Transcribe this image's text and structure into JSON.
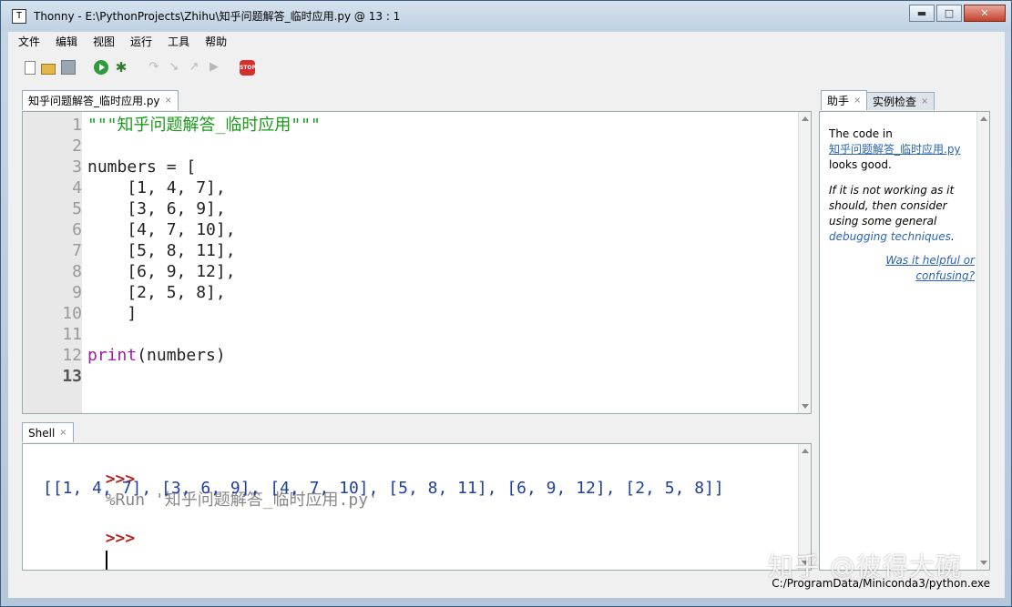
{
  "window": {
    "app_icon_glyph": "T",
    "title": "Thonny  -  E:\\PythonProjects\\Zhihu\\知乎问题解答_临时应用.py  @  13 : 1",
    "minimize_glyph": "▬",
    "maximize_glyph": "□",
    "close_glyph": "✕"
  },
  "menu": [
    "文件",
    "编辑",
    "视图",
    "运行",
    "工具",
    "帮助"
  ],
  "toolbar": {
    "icons": [
      "new-file-icon",
      "open-file-icon",
      "save-icon",
      "run-icon",
      "debug-icon",
      "step-over-icon",
      "step-into-icon",
      "step-out-icon",
      "resume-icon",
      "stop-icon"
    ],
    "stop_label": "STOP"
  },
  "editor": {
    "tab_label": "知乎问题解答_临时应用.py",
    "tab_close": "×",
    "line_numbers": [
      "1",
      "2",
      "3",
      "4",
      "5",
      "6",
      "7",
      "8",
      "9",
      "10",
      "11",
      "12",
      "13"
    ],
    "current_line": "13",
    "lines": [
      {
        "parts": [
          {
            "cls": "str",
            "text": "\"\"\"知乎问题解答_临时应用\"\"\""
          }
        ]
      },
      {
        "parts": []
      },
      {
        "parts": [
          {
            "cls": "normal",
            "text": "numbers = ["
          }
        ]
      },
      {
        "parts": [
          {
            "cls": "normal",
            "text": "    [1, 4, 7],"
          }
        ]
      },
      {
        "parts": [
          {
            "cls": "normal",
            "text": "    [3, 6, 9],"
          }
        ]
      },
      {
        "parts": [
          {
            "cls": "normal",
            "text": "    [4, 7, 10],"
          }
        ]
      },
      {
        "parts": [
          {
            "cls": "normal",
            "text": "    [5, 8, 11],"
          }
        ]
      },
      {
        "parts": [
          {
            "cls": "normal",
            "text": "    [6, 9, 12],"
          }
        ]
      },
      {
        "parts": [
          {
            "cls": "normal",
            "text": "    [2, 5, 8],"
          }
        ]
      },
      {
        "parts": [
          {
            "cls": "normal",
            "text": "    ]"
          }
        ]
      },
      {
        "parts": []
      },
      {
        "parts": [
          {
            "cls": "builtin",
            "text": "print"
          },
          {
            "cls": "normal",
            "text": "(numbers)"
          }
        ]
      },
      {
        "parts": []
      }
    ]
  },
  "shell": {
    "tab_label": "Shell",
    "tab_close": "×",
    "prompt": ">>>",
    "run_command": "%Run '知乎问题解答_临时应用.py'",
    "output": "[[1, 4, 7], [3, 6, 9], [4, 7, 10], [5, 8, 11], [6, 9, 12], [2, 5, 8]]"
  },
  "assistant": {
    "tab_active_label": "助手",
    "tab_active_close": "×",
    "tab_inactive_label": "实例检查",
    "tab_inactive_close": "×",
    "line1": "The code in",
    "file_link": "知乎问题解答_临时应用.py",
    "line3": "looks good.",
    "italic_1": "If it is not working as it",
    "italic_2": "should, then consider",
    "italic_3": "using some general",
    "italic_link": "debugging techniques",
    "italic_period": ".",
    "feedback_1": "Was it helpful or",
    "feedback_2": "confusing?"
  },
  "status": {
    "interpreter": "C:/ProgramData/Miniconda3/python.exe"
  },
  "watermark": "知乎 @彼得大碗"
}
